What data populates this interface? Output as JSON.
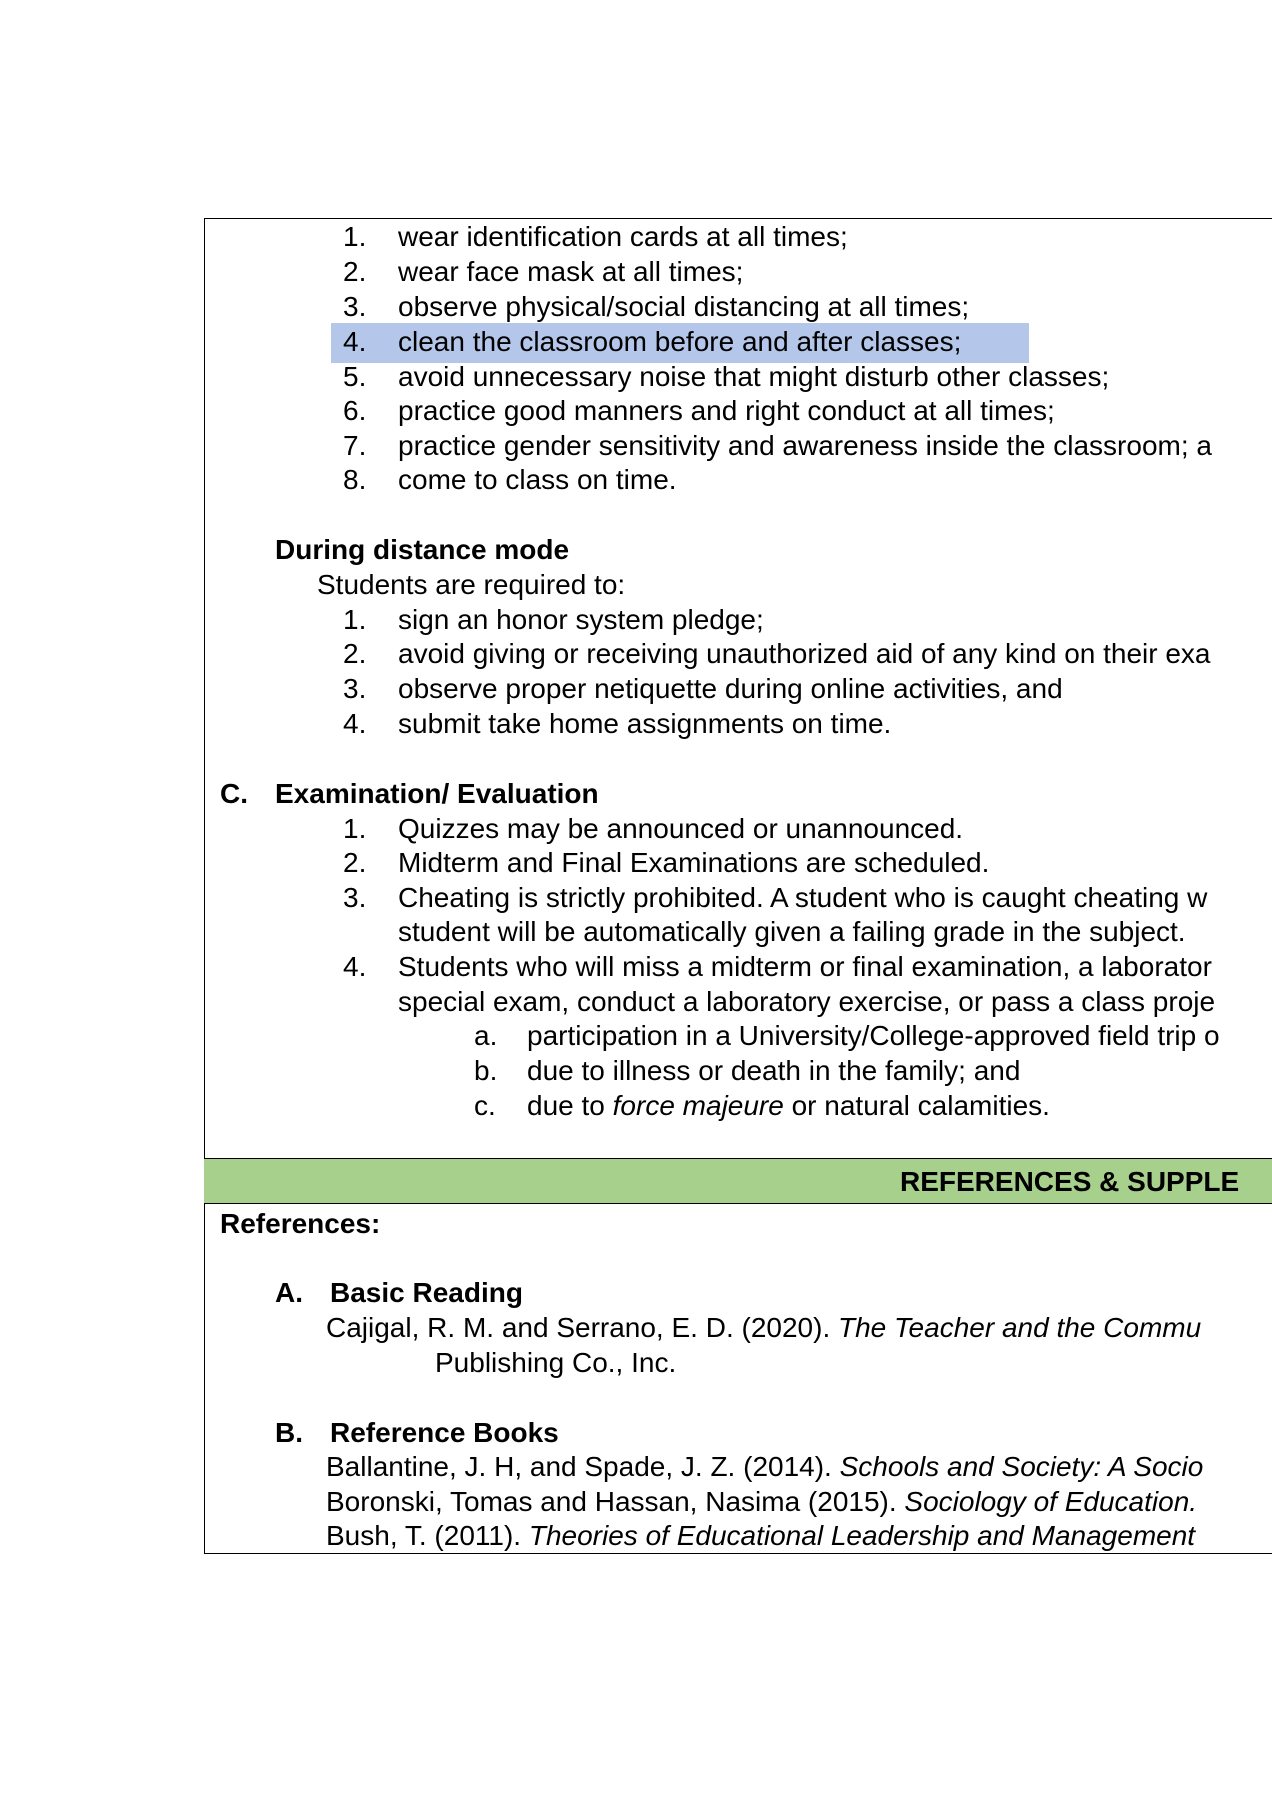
{
  "classroom_list": [
    {
      "num": "1.",
      "text": "wear identification cards at all times;"
    },
    {
      "num": "2.",
      "text": "wear face mask at all times;"
    },
    {
      "num": "3.",
      "text": "observe physical/social distancing at all times;"
    },
    {
      "num": "4.",
      "text": "clean the classroom before and after classes;"
    },
    {
      "num": "5.",
      "text": "avoid unnecessary noise that might disturb other classes;"
    },
    {
      "num": "6.",
      "text": "practice good manners and right conduct at all times;"
    },
    {
      "num": "7.",
      "text": "practice gender sensitivity and awareness inside the classroom; a"
    },
    {
      "num": "8.",
      "text": "come to class on time."
    }
  ],
  "distance": {
    "heading": "During distance mode",
    "intro": "Students are required to:",
    "items": [
      {
        "num": "1.",
        "text": "sign an honor system pledge;"
      },
      {
        "num": "2.",
        "text": "avoid giving or receiving unauthorized aid of any kind on their exa"
      },
      {
        "num": "3.",
        "text": "observe proper netiquette during online activities, and"
      },
      {
        "num": "4.",
        "text": "submit take home assignments on time."
      }
    ]
  },
  "exam": {
    "letter": "C.",
    "heading": "Examination/ Evaluation",
    "items": [
      {
        "num": "1.",
        "line1": "Quizzes may be announced or unannounced."
      },
      {
        "num": "2.",
        "line1": "Midterm and Final Examinations are scheduled."
      },
      {
        "num": "3.",
        "line1": "Cheating is strictly prohibited. A student who is caught cheating w",
        "line2": "student will be automatically given a failing grade in the subject."
      },
      {
        "num": "4.",
        "line1": "Students who will miss a midterm or final examination, a laborator",
        "line2": "special exam, conduct a laboratory exercise, or pass a class proje"
      }
    ],
    "subitems": [
      {
        "letter": "a.",
        "text": "participation in a University/College-approved field trip o"
      },
      {
        "letter": "b.",
        "text": "due to illness or death in the family; and"
      },
      {
        "letter": "c.",
        "pre": "due to ",
        "italic": "force majeure",
        "post": " or natural calamities."
      }
    ]
  },
  "references_bar": {
    "title": "REFERENCES & SUPPLE",
    "color": "#a8d08d"
  },
  "references": {
    "label": "References:",
    "basic": {
      "letter": "A.",
      "heading": "Basic Reading",
      "entry_plain": "Cajigal, R. M. and Serrano, E. D. (2020). ",
      "entry_italic": "The Teacher and the Commu",
      "entry_cont": "Publishing Co., Inc."
    },
    "books": {
      "letter": "B.",
      "heading": "Reference Books",
      "entries": [
        {
          "plain": "Ballantine, J. H, and Spade, J. Z. (2014). ",
          "italic": "Schools and Society: A Socio"
        },
        {
          "plain": "Boronski, Tomas and Hassan, Nasima (2015). ",
          "italic": "Sociology of Education."
        },
        {
          "plain": "Bush, T. (2011). ",
          "italic": "Theories of Educational Leadership and Management"
        }
      ]
    }
  },
  "highlight_color": "#b4c6ea"
}
